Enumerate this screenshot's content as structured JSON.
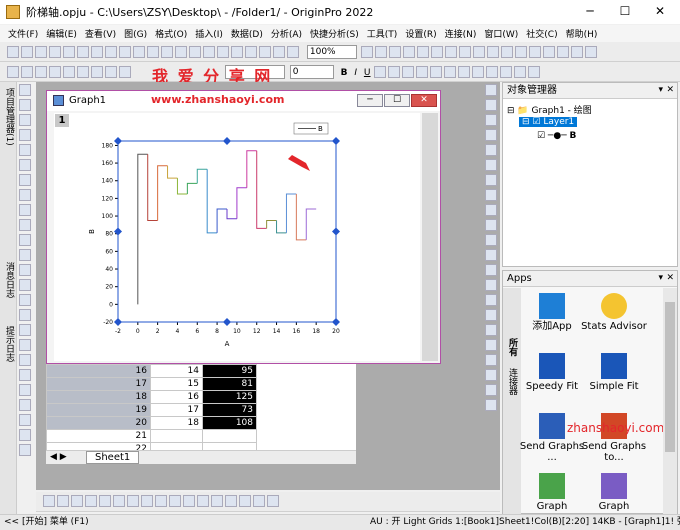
{
  "window": {
    "title": "阶梯轴.opju - C:\\Users\\ZSY\\Desktop\\ - /Folder1/ - OriginPro 2022"
  },
  "menu": [
    "文件(F)",
    "编辑(E)",
    "查看(V)",
    "图(G)",
    "格式(O)",
    "插入(I)",
    "数据(D)",
    "分析(A)",
    "快捷分析(S)",
    "工具(T)",
    "设置(R)",
    "连接(N)",
    "窗口(W)",
    "社交(C)",
    "帮助(H)"
  ],
  "toolbar": {
    "zoom": "100%",
    "font_size": "0"
  },
  "watermark": {
    "top_text": "我 爱 分 享 网",
    "url": "www.zhanshaoyi.com",
    "url2": "zhanshaoyi.com"
  },
  "left_panels": [
    "项目管理器(1)",
    "消息日志",
    "提示日志"
  ],
  "graph_window": {
    "title": "Graph1",
    "layer_number": "1"
  },
  "graph": {
    "legend": "B",
    "accent": "#2255cc"
  },
  "chart_data": {
    "type": "line",
    "subtype": "step",
    "xlabel": "A",
    "ylabel": "B",
    "xlim": [
      -2,
      20
    ],
    "ylim": [
      -20,
      185
    ],
    "x_ticks": [
      "-2",
      "0",
      "2",
      "4",
      "6",
      "8",
      "10",
      "12",
      "14",
      "16",
      "18",
      "20"
    ],
    "y_ticks": [
      "-20",
      "0",
      "20",
      "40",
      "60",
      "80",
      "100",
      "120",
      "140",
      "160",
      "180"
    ],
    "series": [
      {
        "name": "B",
        "x": [
          0,
          1,
          2,
          3,
          4,
          5,
          6,
          7,
          8,
          9,
          10,
          11,
          12,
          13,
          14,
          15,
          16,
          17,
          18
        ],
        "y": [
          0,
          170,
          95,
          157,
          143,
          125,
          137,
          153,
          81,
          108,
          97,
          132,
          174,
          86,
          95,
          81,
          125,
          73,
          108
        ]
      }
    ]
  },
  "worksheet": {
    "rows": [
      {
        "row": "16",
        "a": "14",
        "b": "95"
      },
      {
        "row": "17",
        "a": "15",
        "b": "81"
      },
      {
        "row": "18",
        "a": "16",
        "b": "125"
      },
      {
        "row": "19",
        "a": "17",
        "b": "73"
      },
      {
        "row": "20",
        "a": "18",
        "b": "108"
      },
      {
        "row": "21",
        "a": "",
        "b": ""
      },
      {
        "row": "22",
        "a": "",
        "b": ""
      }
    ],
    "tab": "Sheet1"
  },
  "object_manager": {
    "title": "对象管理器",
    "items": [
      "Graph1 - 绘图",
      "Layer1",
      "B"
    ]
  },
  "apps": {
    "title": "Apps",
    "side_tabs": [
      "所有",
      "连接器"
    ],
    "items": [
      {
        "label": "添加App"
      },
      {
        "label": "Stats Advisor"
      },
      {
        "label": "Speedy Fit"
      },
      {
        "label": "Simple Fit"
      },
      {
        "label": "Send Graphs ..."
      },
      {
        "label": "Send Graphs to..."
      },
      {
        "label": "Graph"
      },
      {
        "label": "Graph"
      }
    ]
  },
  "status": {
    "left": "<< [开始] 菜单 (F1)",
    "right": "AU : 开  Light Grids 1:[Book1]Sheet1!Col(B)[2:20]  14KB - [Graph1]1! 弧度"
  }
}
